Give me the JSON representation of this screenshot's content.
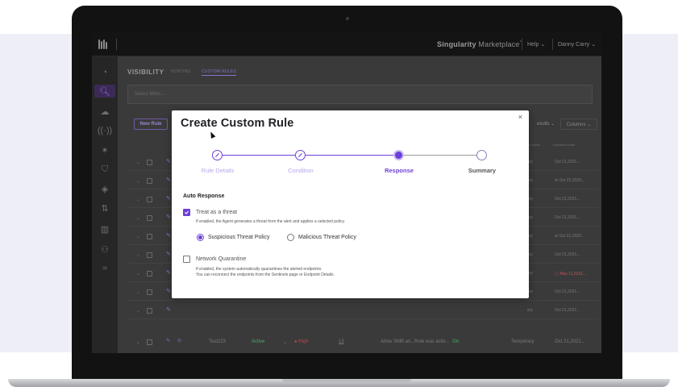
{
  "header": {
    "brand_bold": "Singularity",
    "brand_light": "Marketplace",
    "brand_mark": "°",
    "help": "Help ⌄",
    "user": "Danny Carry ⌄"
  },
  "page": {
    "title": "VISIBILITY",
    "tabs": [
      "HUNTING",
      "CUSTOM RULES"
    ],
    "filter_placeholder": "Select filters...",
    "new_rule": "New Rule",
    "results": "esults ⌄",
    "columns": "Columns ⌄",
    "col_expiration_mode": "on Mode",
    "col_expiration_date": "Expiration Date"
  },
  "rows": [
    {
      "mode": "ary",
      "date": "Oct 21,2021...",
      "alert": false
    },
    {
      "mode": "ary",
      "date": "⊘ Oct 21,2020...",
      "alert": false
    },
    {
      "mode": "ary",
      "date": "Oct 21,2021...",
      "alert": false
    },
    {
      "mode": "ary",
      "date": "Oct 21,2021...",
      "alert": false
    },
    {
      "mode": "ary",
      "date": "⊘ Oct 21,2020...",
      "alert": false
    },
    {
      "mode": "ary",
      "date": "Oct 21,2021...",
      "alert": false
    },
    {
      "mode": "ary",
      "date": "ⓘ May 11,2021...",
      "alert": true
    },
    {
      "mode": "ary",
      "date": "Oct 21,2021...",
      "alert": false
    },
    {
      "mode": "ary",
      "date": "Oct 21,2021...",
      "alert": false
    }
  ],
  "last_row": {
    "name": "Test223",
    "status": "Active",
    "severity": "● High",
    "count": "13",
    "action": "Allow SMB an...",
    "desc": "Rule was activ...",
    "state": "On",
    "mode": "Temporary",
    "date": "Oct 21,2021..."
  },
  "modal": {
    "title": "Create Custom Rule",
    "close": "×",
    "steps": [
      {
        "label": "Rule Details",
        "state": "done"
      },
      {
        "label": "Condition",
        "state": "done"
      },
      {
        "label": "Response",
        "state": "current"
      },
      {
        "label": "Summary",
        "state": "todo"
      }
    ],
    "section_title": "Auto Response",
    "treat": {
      "label": "Treat as a threat",
      "checked": true,
      "description": "If enabled, the Agent generates a threat from the alert and applies a selected policy."
    },
    "policies": [
      {
        "label": "Suspicious Threat Policy",
        "selected": true
      },
      {
        "label": "Malicious Threat Policy",
        "selected": false
      }
    ],
    "quarantine": {
      "label": "Network Quarantine",
      "checked": false,
      "description_1": "If enabled, the system automatically quarantines the alerted endpoints.",
      "description_2": "You can reconnect the endpoints from the Sentinels page or Endpoint Details."
    }
  },
  "colors": {
    "accent": "#6c3fd8",
    "accent_light": "#b8a5ec",
    "app_dark": "#2d2d2d"
  }
}
